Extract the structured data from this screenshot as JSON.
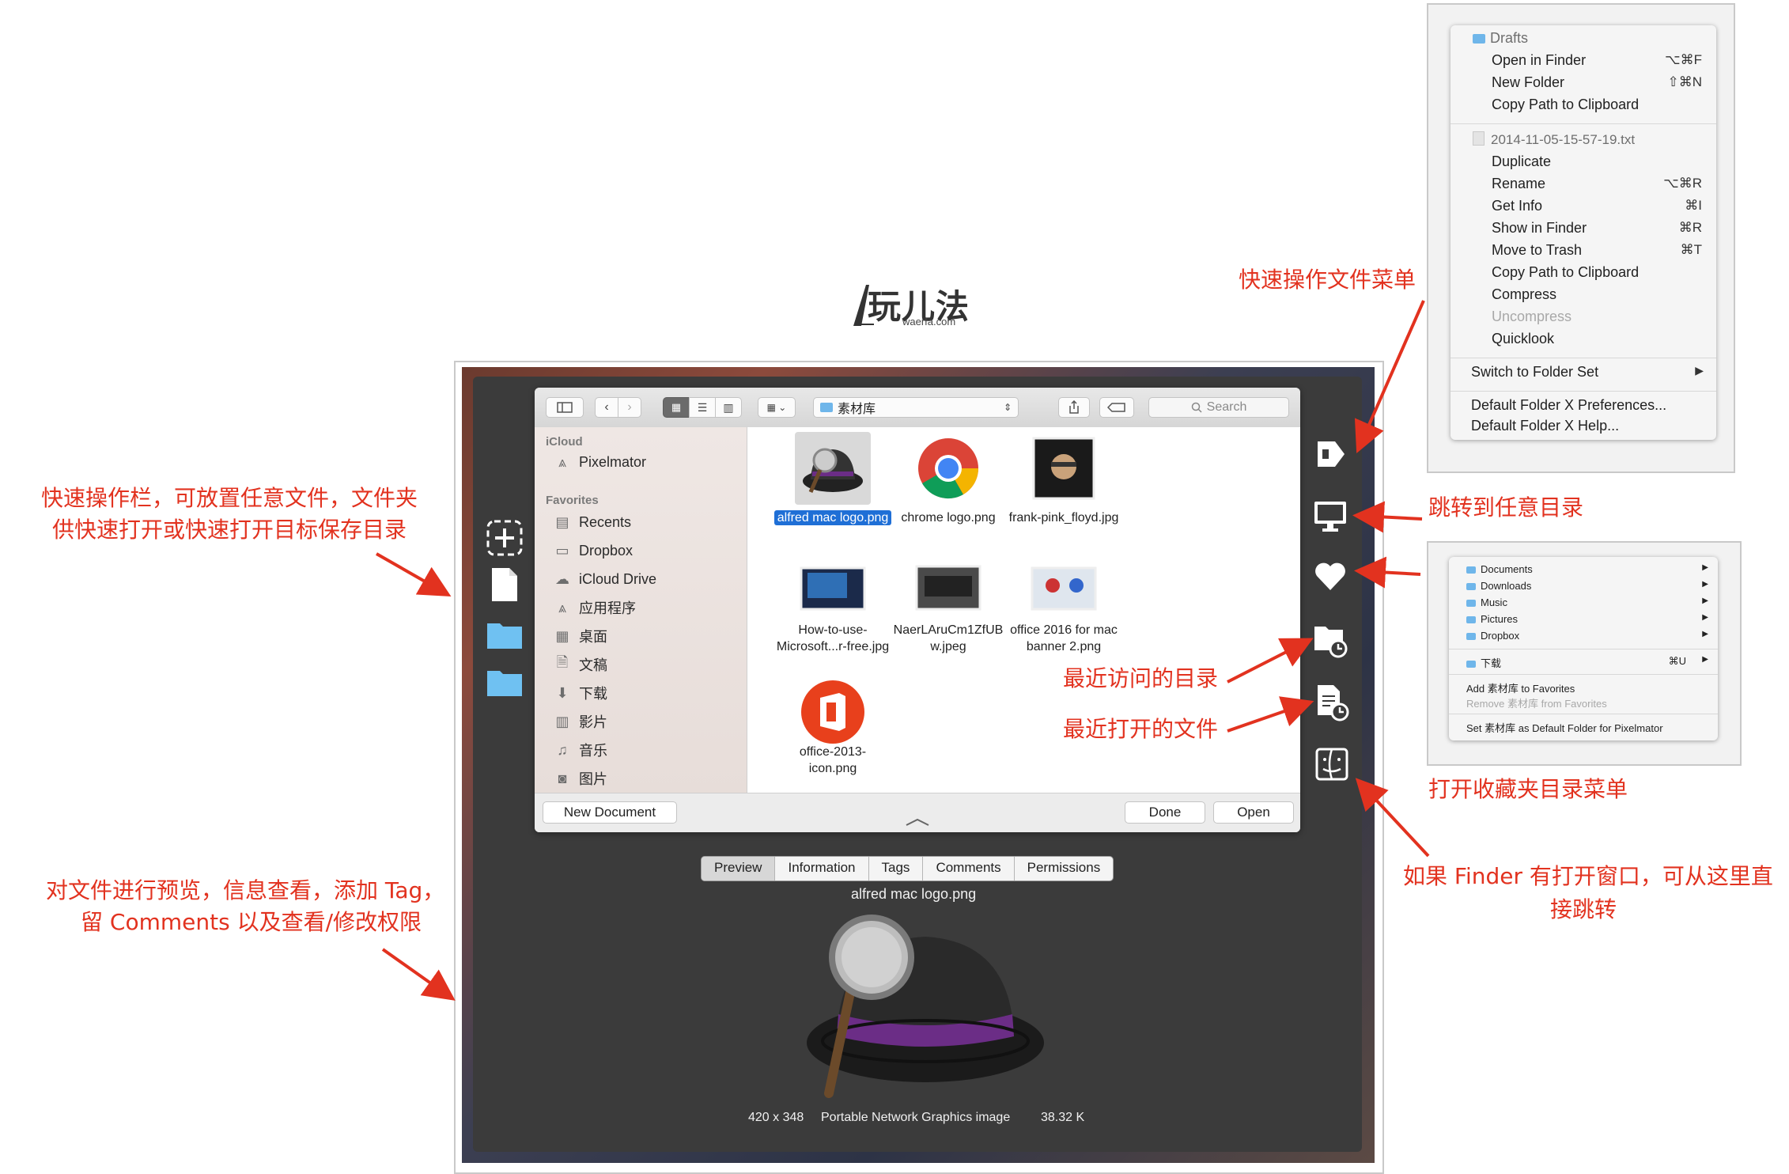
{
  "logo": {
    "main": "玩儿法",
    "sub": "waerfa.com"
  },
  "callouts": {
    "quick_bar_line1": "快速操作栏，可放置任意文件，文件夹",
    "quick_bar_line2": "供快速打开或快速打开目标保存目录",
    "preview_line1": "对文件进行预览，信息查看，添加 Tag，",
    "preview_line2": "留 Comments 以及查看/修改权限",
    "file_menu": "快速操作文件菜单",
    "jump_any": "跳转到任意目录",
    "recent_dirs": "最近访问的目录",
    "recent_files": "最近打开的文件",
    "favorites_menu": "打开收藏夹目录菜单",
    "finder_line1": "如果 Finder 有打开窗口，可从这里直",
    "finder_line2": "接跳转"
  },
  "dialog": {
    "path_popup": "素材库",
    "search_placeholder": "Search",
    "sidebar": {
      "icloud_header": "iCloud",
      "icloud_items": [
        {
          "label": "Pixelmator",
          "icon": "app-icon"
        }
      ],
      "favorites_header": "Favorites",
      "favorites_items": [
        {
          "label": "Recents",
          "icon": "recents-icon"
        },
        {
          "label": "Dropbox",
          "icon": "folder-icon"
        },
        {
          "label": "iCloud Drive",
          "icon": "cloud-icon"
        },
        {
          "label": "应用程序",
          "icon": "app-icon"
        },
        {
          "label": "桌面",
          "icon": "desktop-icon"
        },
        {
          "label": "文稿",
          "icon": "document-icon"
        },
        {
          "label": "下载",
          "icon": "download-icon"
        },
        {
          "label": "影片",
          "icon": "film-icon"
        },
        {
          "label": "音乐",
          "icon": "music-icon"
        },
        {
          "label": "图片",
          "icon": "camera-icon"
        }
      ]
    },
    "files": [
      {
        "name_line1": "alfred mac logo.png",
        "name_line2": "",
        "selected": true
      },
      {
        "name_line1": "chrome logo.png",
        "name_line2": "",
        "selected": false
      },
      {
        "name_line1": "frank-pink_floyd.jpg",
        "name_line2": "",
        "selected": false
      },
      {
        "name_line1": "How-to-use-",
        "name_line2": "Microsoft...r-free.jpg",
        "selected": false
      },
      {
        "name_line1": "NaerLAruCm1ZfUB",
        "name_line2": "w.jpeg",
        "selected": false
      },
      {
        "name_line1": "office 2016 for mac",
        "name_line2": "banner 2.png",
        "selected": false
      },
      {
        "name_line1": "office-2013-",
        "name_line2": "icon.png",
        "selected": false
      }
    ],
    "new_document": "New Document",
    "done": "Done",
    "open": "Open"
  },
  "inspector": {
    "tabs": [
      "Preview",
      "Information",
      "Tags",
      "Comments",
      "Permissions"
    ],
    "active_tab": "Preview",
    "file_name": "alfred mac logo.png",
    "dimensions": "420 x 348",
    "kind": "Portable Network Graphics image",
    "size": "38.32 K"
  },
  "file_menu": {
    "folder_header": "Drafts",
    "folder_items": [
      {
        "label": "Open in Finder",
        "shortcut": "⌥⌘F"
      },
      {
        "label": "New Folder",
        "shortcut": "⇧⌘N"
      },
      {
        "label": "Copy Path to Clipboard",
        "shortcut": ""
      }
    ],
    "file_header": "2014-11-05-15-57-19.txt",
    "file_items": [
      {
        "label": "Duplicate",
        "shortcut": "",
        "disabled": false
      },
      {
        "label": "Rename",
        "shortcut": "⌥⌘R",
        "disabled": false
      },
      {
        "label": "Get Info",
        "shortcut": "⌘I",
        "disabled": false
      },
      {
        "label": "Show in Finder",
        "shortcut": "⌘R",
        "disabled": false
      },
      {
        "label": "Move to Trash",
        "shortcut": "⌘T",
        "disabled": false
      },
      {
        "label": "Copy Path to Clipboard",
        "shortcut": "",
        "disabled": false
      },
      {
        "label": "Compress",
        "shortcut": "",
        "disabled": false
      },
      {
        "label": "Uncompress",
        "shortcut": "",
        "disabled": true
      },
      {
        "label": "Quicklook",
        "shortcut": "",
        "disabled": false
      }
    ],
    "switch_label": "Switch to Folder Set",
    "prefs": "Default Folder X Preferences...",
    "help": "Default Folder X Help..."
  },
  "favorites_menu": {
    "items": [
      "Documents",
      "Downloads",
      "Music",
      "Pictures",
      "Dropbox"
    ],
    "downloads_label": "下载",
    "downloads_shortcut": "⌘U",
    "add_label": "Add 素材库 to Favorites",
    "remove_label": "Remove 素材库 from Favorites",
    "set_default_label": "Set 素材库 as Default Folder for Pixelmator"
  },
  "colors": {
    "accent_red": "#e2321f",
    "selection_blue": "#1f6fd6",
    "folder_blue": "#6fb6ea"
  }
}
